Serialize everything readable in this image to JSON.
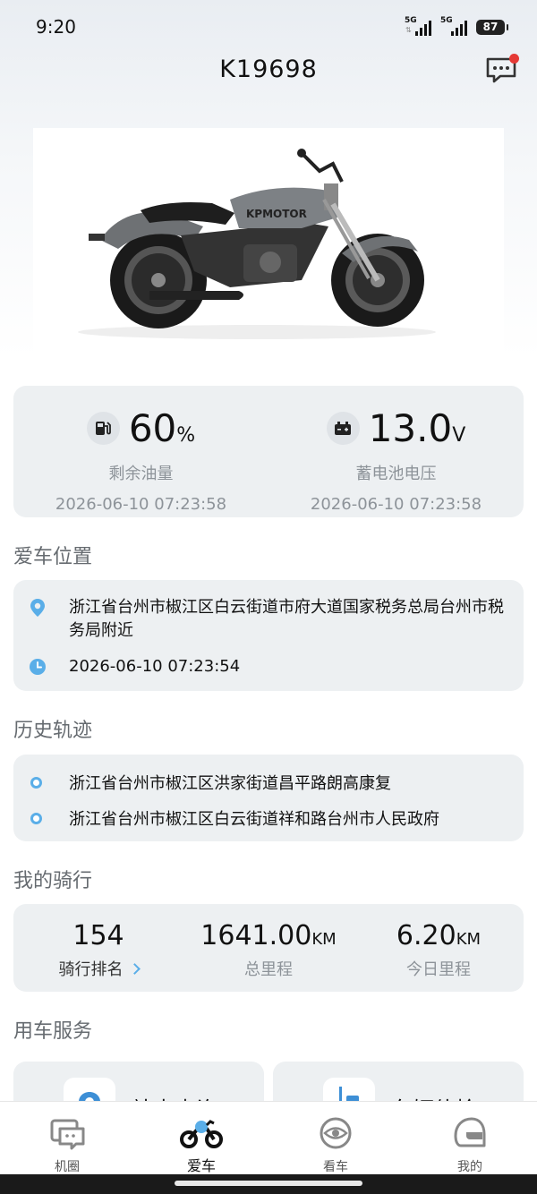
{
  "status_bar": {
    "time": "9:20",
    "signal1_label": "5G",
    "signal2_label": "5G",
    "battery": "87"
  },
  "header": {
    "title": "K19698",
    "message_icon": "message-icon"
  },
  "bike": {
    "image_icon": "motorcycle-image",
    "tank_text": "KPMOTOR"
  },
  "stats": {
    "fuel": {
      "icon": "fuel-icon",
      "value": "60",
      "unit": "%",
      "label": "剩余油量",
      "time": "2026-06-10 07:23:58"
    },
    "battery": {
      "icon": "battery-icon",
      "value": "13.0",
      "unit": "V",
      "label": "蓄电池电压",
      "time": "2026-06-10 07:23:58"
    }
  },
  "location": {
    "section_title": "爱车位置",
    "address": "浙江省台州市椒江区白云街道市府大道国家税务总局台州市税务局附近",
    "time": "2026-06-10 07:23:54"
  },
  "history": {
    "section_title": "历史轨迹",
    "items": [
      "浙江省台州市椒江区洪家街道昌平路朗高康复",
      "浙江省台州市椒江区白云街道祥和路台州市人民政府"
    ]
  },
  "ride": {
    "section_title": "我的骑行",
    "rank": {
      "value": "154",
      "label": "骑行排名"
    },
    "total": {
      "value": "1641.00",
      "unit": "KM",
      "label": "总里程"
    },
    "today": {
      "value": "6.20",
      "unit": "KM",
      "label": "今日里程"
    }
  },
  "services": {
    "section_title": "用车服务",
    "items": [
      {
        "label": "站点查询",
        "icon": "station-icon"
      },
      {
        "label": "车辆体检",
        "icon": "vehicle-check-icon"
      }
    ]
  },
  "nav": {
    "items": [
      {
        "label": "机圈",
        "icon": "community-icon"
      },
      {
        "label": "爱车",
        "icon": "my-bike-icon"
      },
      {
        "label": "看车",
        "icon": "browse-bikes-icon"
      },
      {
        "label": "我的",
        "icon": "profile-helmet-icon"
      }
    ],
    "active": "爱车"
  },
  "colors": {
    "accent": "#5aaee8",
    "card_bg": "#edf0f2",
    "badge_red": "#e53935"
  }
}
